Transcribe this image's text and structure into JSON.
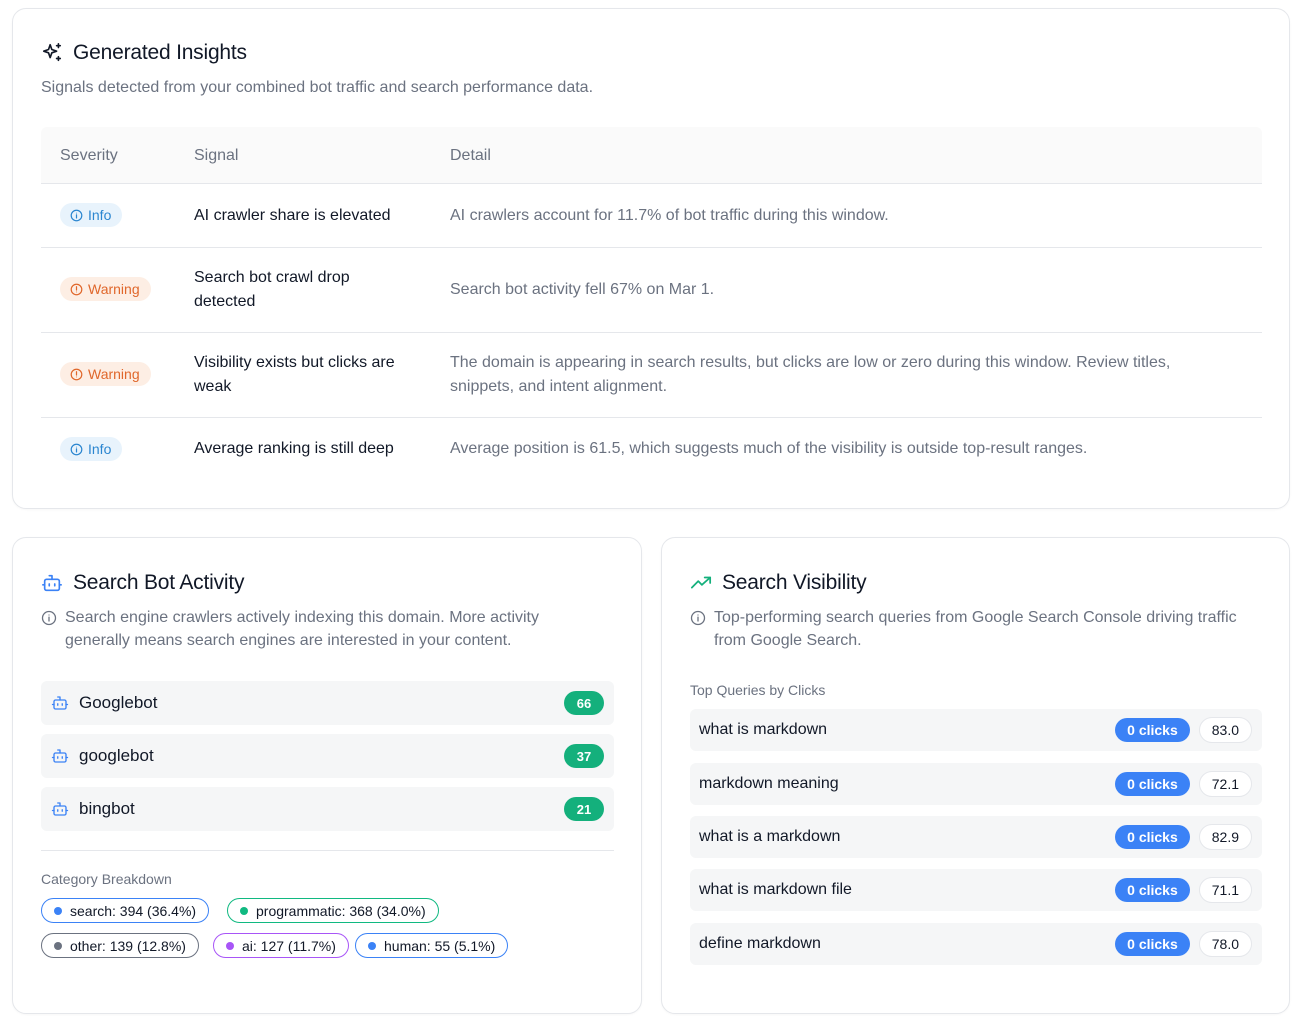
{
  "insights": {
    "title": "Generated Insights",
    "subtitle": "Signals detected from your combined bot traffic and search performance data.",
    "columns": {
      "severity": "Severity",
      "signal": "Signal",
      "detail": "Detail"
    },
    "rows": [
      {
        "severity": "Info",
        "signal": "AI crawler share is elevated",
        "detail": "AI crawlers account for 11.7% of bot traffic during this window."
      },
      {
        "severity": "Warning",
        "signal": "Search bot crawl drop detected",
        "detail": "Search bot activity fell 67% on Mar 1."
      },
      {
        "severity": "Warning",
        "signal": "Visibility exists but clicks are weak",
        "detail": "The domain is appearing in search results, but clicks are low or zero during this window. Review titles, snippets, and intent alignment."
      },
      {
        "severity": "Info",
        "signal": "Average ranking is still deep",
        "detail": "Average position is 61.5, which suggests much of the visibility is outside top-result ranges."
      }
    ]
  },
  "bots": {
    "title": "Search Bot Activity",
    "description": "Search engine crawlers actively indexing this domain. More activity generally means search engines are interested in your content.",
    "items": [
      {
        "name": "Googlebot",
        "count": "66"
      },
      {
        "name": "googlebot",
        "count": "37"
      },
      {
        "name": "bingbot",
        "count": "21"
      }
    ],
    "category_label": "Category Breakdown",
    "categories": [
      {
        "label": "search: 394 (36.4%)",
        "color": "#3b82f6"
      },
      {
        "label": "programmatic: 368 (34.0%)",
        "color": "#10b981"
      },
      {
        "label": "other: 139 (12.8%)",
        "color": "#6b7280"
      },
      {
        "label": "ai: 127 (11.7%)",
        "color": "#a855f7"
      },
      {
        "label": "human: 55 (5.1%)",
        "color": "#3b82f6"
      }
    ]
  },
  "visibility": {
    "title": "Search Visibility",
    "description": "Top-performing search queries from Google Search Console driving traffic from Google Search.",
    "queries_label": "Top Queries by Clicks",
    "queries": [
      {
        "query": "what is markdown",
        "clicks": "0 clicks",
        "position": "83.0"
      },
      {
        "query": "markdown meaning",
        "clicks": "0 clicks",
        "position": "72.1"
      },
      {
        "query": "what is a markdown",
        "clicks": "0 clicks",
        "position": "82.9"
      },
      {
        "query": "what is markdown file",
        "clicks": "0 clicks",
        "position": "71.1"
      },
      {
        "query": "define markdown",
        "clicks": "0 clicks",
        "position": "78.0"
      }
    ]
  },
  "colors": {
    "info": "#2b86d0",
    "warning": "#e0672b",
    "bot_count": "#14b07c",
    "clicks": "#3b82f6"
  },
  "icons": {
    "insights": "sparkles-icon",
    "bots": "bot-icon",
    "visibility": "trending-up-icon",
    "info": "info-circle-icon"
  }
}
